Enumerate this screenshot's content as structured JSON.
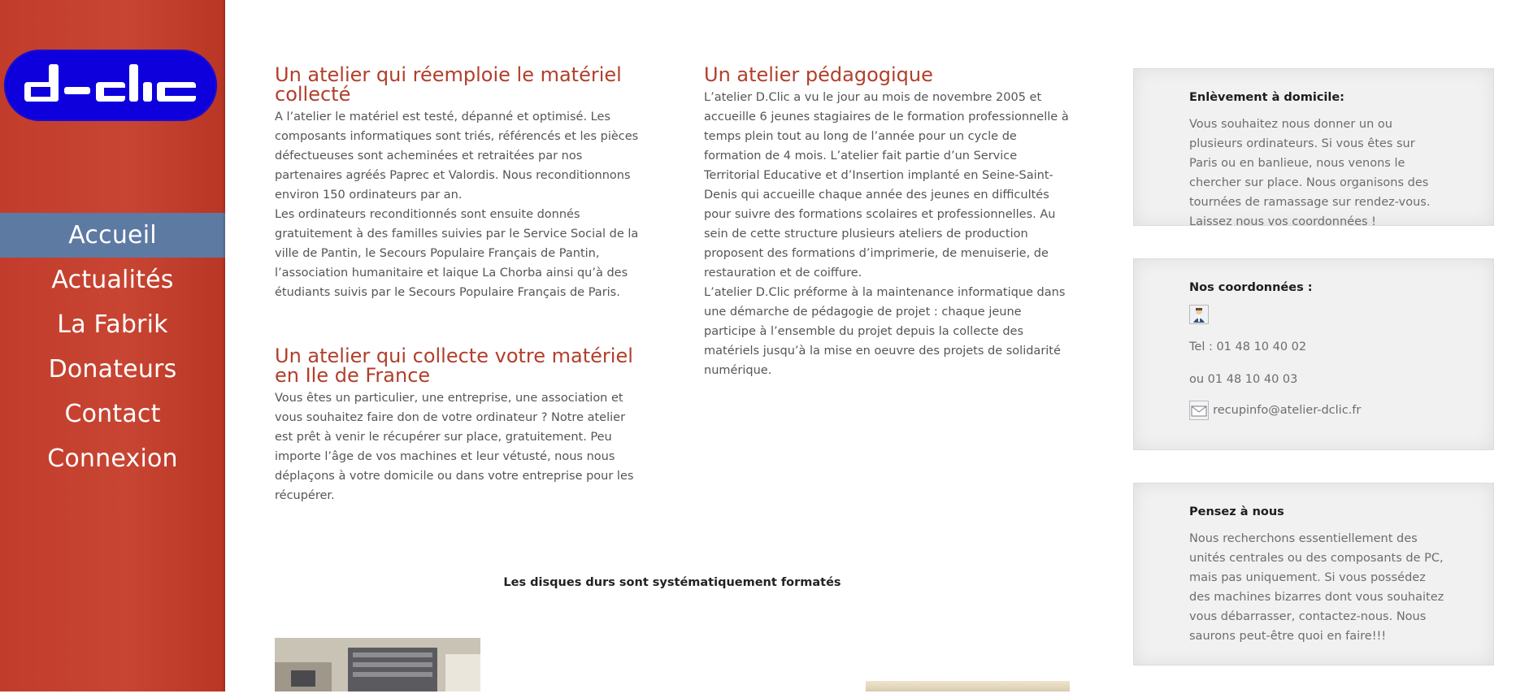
{
  "brand": {
    "logo_text": "d-clic"
  },
  "nav": {
    "items": [
      {
        "label": "Accueil",
        "active": true
      },
      {
        "label": "Actualités"
      },
      {
        "label": "La Fabrik"
      },
      {
        "label": "Donateurs"
      },
      {
        "label": "Contact"
      },
      {
        "label": "Connexion"
      }
    ]
  },
  "main": {
    "sec1": {
      "title": "Un atelier qui réemploie le matériel collecté",
      "paragraphs": [
        "A l’atelier le matériel est testé, dépanné et optimisé. Les composants informatiques sont triés, référencés et les pièces défectueuses sont acheminées et retraitées par nos partenaires agréés Paprec et Valordis. Nous reconditionnons environ 150 ordinateurs par an.",
        "Les ordinateurs reconditionnés sont ensuite donnés gratuitement à des familles suivies par le Service Social de la ville de Pantin, le Secours Populaire Français de Pantin, l’association humanitaire et laique La Chorba ainsi qu’à des étudiants suivis par le Secours Populaire Français de Paris."
      ]
    },
    "sec2": {
      "title": "Un atelier qui collecte votre matériel en Ile de France",
      "paragraphs": [
        "Vous êtes un particulier, une entreprise, une association et vous souhaitez faire don de votre ordinateur ? Notre atelier est prêt à venir le récupérer sur place, gratuitement. Peu importe l’âge de vos machines et leur vétusté, nous nous déplaçons à votre domicile ou dans votre entreprise pour les récupérer."
      ]
    },
    "sec3": {
      "title": "Un atelier pédagogique",
      "paragraphs": [
        "L’atelier D.Clic a vu le jour au mois de novembre 2005 et accueille 6 jeunes stagiaires de le formation professionnelle à temps plein tout au long de l’année pour un cycle de formation de 4 mois. L’atelier fait partie d’un Service Territorial Educative et d’Insertion implanté en Seine-Saint-Denis qui accueille chaque année des jeunes en difficultés pour suivre des formations scolaires et professionnelles. Au sein de cette structure plusieurs ateliers de production proposent des formations d’imprimerie, de menuiserie, de restauration et de coiffure.",
        "L’atelier D.Clic préforme à la maintenance informatique dans une démarche de pédagogie de projet : chaque jeune participe à l’ensemble du projet depuis la collecte des matériels jusqu’à la mise en oeuvre des projets de solidarité numérique."
      ]
    },
    "caption": "Les disques durs sont systématiquement formatés"
  },
  "sidebar_right": {
    "pickup": {
      "title": "Enlèvement à domicile:",
      "text": "Vous souhaitez nous donner un ou plusieurs ordinateurs. Si vous êtes sur Paris ou en banlieue, nous venons le chercher sur place. Nous organisons des tournées de ramassage sur rendez-vous. Laissez nous vos coordonnées !"
    },
    "contact": {
      "title": "Nos coordonnées :",
      "tel1": "Tel : 01 48 10 40 02",
      "tel2": "ou 01 48 10 40 03",
      "email": "recupinfo@atelier-dclic.fr",
      "icons": [
        "person-icon",
        "mail-icon"
      ]
    },
    "think": {
      "title": "Pensez à nous",
      "text": "Nous recherchons essentiellement des unités centrales ou des composants de PC, mais pas uniquement. Si vous possédez des machines bizarres dont vous souhaitez vous débarrasser, contactez-nous. Nous saurons peut-être quoi en faire!!!"
    }
  },
  "colors": {
    "sidebar_red": "#c23c2b",
    "nav_active": "#5d7aa3",
    "heading_red": "#b13f2b",
    "logo_blue": "#0d00dd"
  }
}
